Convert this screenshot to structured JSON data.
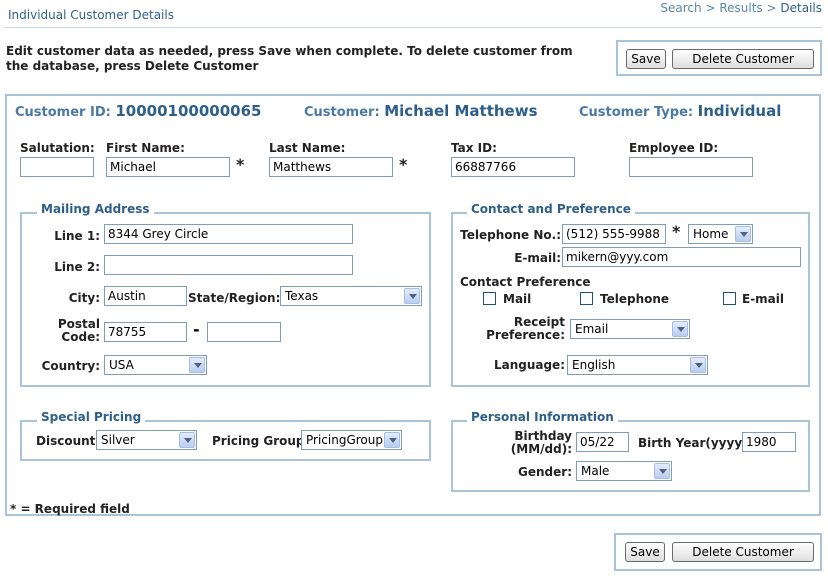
{
  "page": {
    "title": "Individual Customer Details",
    "breadcrumb": {
      "search": "Search",
      "sep1": ">",
      "results": "Results",
      "sep2": ">",
      "details": "Details"
    },
    "intro": "Edit customer data as needed, press Save when complete. To delete customer from the database, press Delete Customer"
  },
  "buttons": {
    "save": "Save",
    "delete": "Delete Customer"
  },
  "header": {
    "customer_id_label": "Customer ID:",
    "customer_id": "10000100000065",
    "customer_label": "Customer:",
    "customer_name": "Michael Matthews",
    "type_label": "Customer Type:",
    "type_value": "Individual"
  },
  "personal": {
    "salutation_label": "Salutation:",
    "salutation": "",
    "first_name_label": "First Name:",
    "first_name": "Michael",
    "last_name_label": "Last Name:",
    "last_name": "Matthews",
    "tax_id_label": "Tax ID:",
    "tax_id": "66887766",
    "employee_id_label": "Employee ID:",
    "employee_id": ""
  },
  "required_mark": "*",
  "mailing": {
    "legend": "Mailing Address",
    "line1_label": "Line 1:",
    "line1": "8344 Grey Circle",
    "line2_label": "Line 2:",
    "line2": "",
    "city_label": "City:",
    "city": "Austin",
    "state_label": "State/Region:",
    "state": "Texas",
    "postal_label_1": "Postal",
    "postal_label_2": "Code:",
    "postal": "78755",
    "postal_dash": "-",
    "postal_ext": "",
    "country_label": "Country:",
    "country": "USA"
  },
  "contact": {
    "legend": "Contact and Preference",
    "telephone_label": "Telephone No.:",
    "telephone": "(512) 555-9988",
    "phone_type": "Home",
    "email_label": "E-mail:",
    "email": "mikern@yyy.com",
    "pref_label": "Contact Preference",
    "pref_mail": "Mail",
    "pref_telephone": "Telephone",
    "pref_email": "E-mail",
    "receipt_label_1": "Receipt",
    "receipt_label_2": "Preference:",
    "receipt": "Email",
    "language_label": "Language:",
    "language": "English"
  },
  "pricing": {
    "legend": "Special Pricing",
    "discount_label": "Discount:",
    "discount": "Silver",
    "group_label": "Pricing Group:",
    "group": "PricingGroup"
  },
  "personal_info": {
    "legend": "Personal Information",
    "birthday_label_1": "Birthday",
    "birthday_label_2": "(MM/dd):",
    "birthday": "05/22",
    "birth_year_label": "Birth Year(yyyy):",
    "birth_year": "1980",
    "gender_label": "Gender:",
    "gender": "Male"
  },
  "footnote": "* = Required field"
}
